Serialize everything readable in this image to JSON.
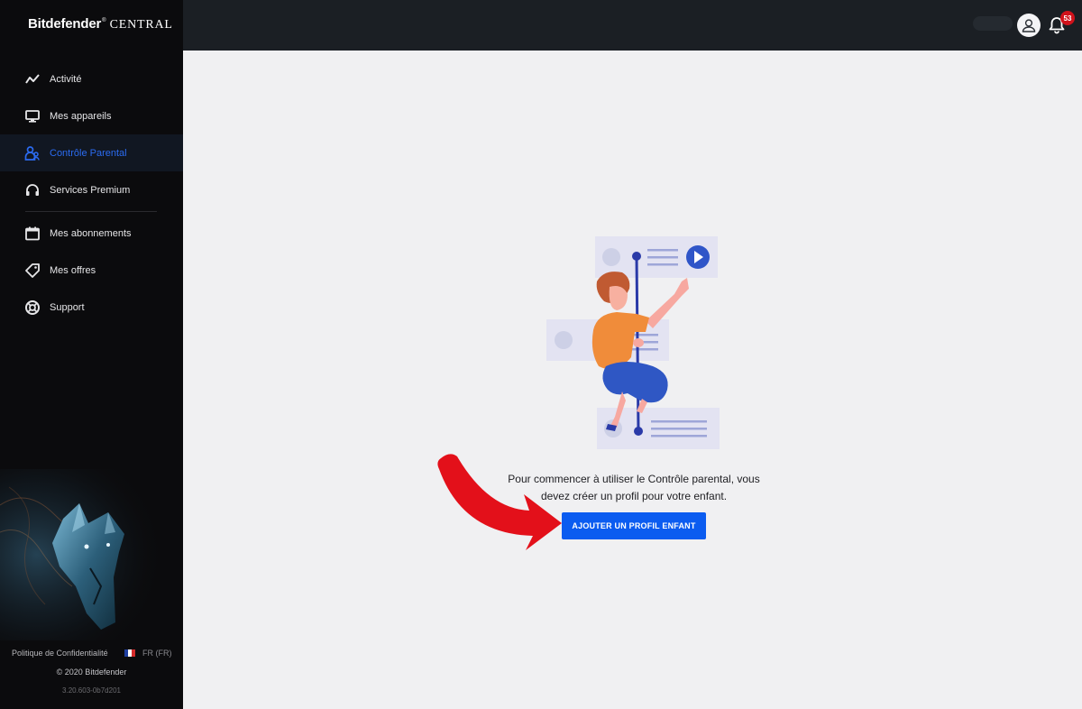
{
  "brand": {
    "name": "Bitdefender",
    "reg": "®",
    "product": "CENTRAL"
  },
  "sidebar": {
    "items": [
      {
        "label": "Activité",
        "icon": "activity-icon"
      },
      {
        "label": "Mes appareils",
        "icon": "monitor-icon"
      },
      {
        "label": "Contrôle Parental",
        "icon": "parental-icon",
        "active": true
      },
      {
        "label": "Services Premium",
        "icon": "headset-icon"
      },
      {
        "label": "Mes abonnements",
        "icon": "calendar-icon"
      },
      {
        "label": "Mes offres",
        "icon": "tag-icon"
      },
      {
        "label": "Support",
        "icon": "lifebuoy-icon"
      }
    ],
    "footer": {
      "privacy": "Politique de Confidentialité",
      "lang": "FR (FR)",
      "copyright": "© 2020 Bitdefender",
      "version": "3.20.603-0b7d201"
    }
  },
  "header": {
    "notifications_count": "53"
  },
  "main": {
    "message_line1": "Pour commencer à utiliser le Contrôle parental, vous",
    "message_line2": "devez créer un profil pour votre enfant.",
    "cta_label": "AJOUTER UN PROFIL ENFANT"
  },
  "colors": {
    "accent": "#0b5cf0",
    "active_nav": "#2b6bf0",
    "badge": "#d0121b",
    "arrow": "#e3101a"
  }
}
